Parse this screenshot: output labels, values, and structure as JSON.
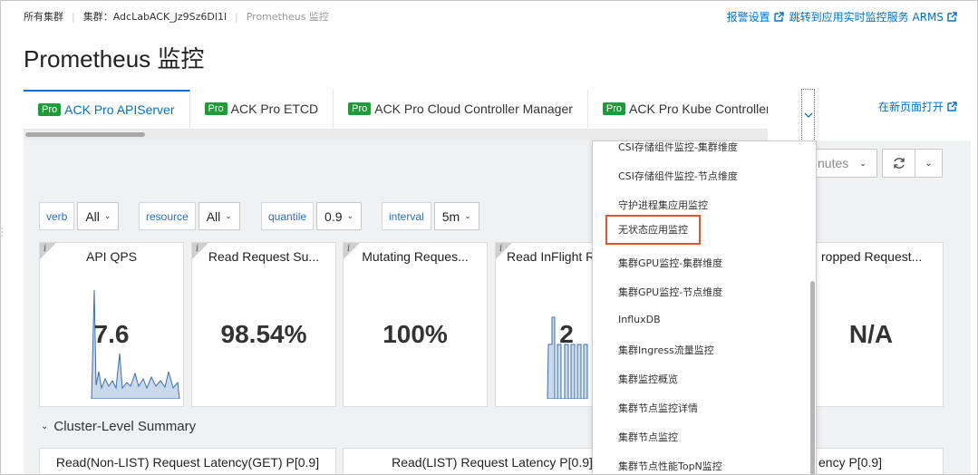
{
  "breadcrumb": {
    "items": [
      "所有集群",
      "集群：",
      "AdcLabACK_Jz9Sz6Dl1l",
      "Prometheus 监控"
    ]
  },
  "header_links": {
    "alarm": "报警设置",
    "arms": "跳转到应用实时监控服务 ARMS"
  },
  "page_title": "Prometheus 监控",
  "tabs": [
    {
      "badge": "Pro",
      "label": "ACK Pro APIServer"
    },
    {
      "badge": "Pro",
      "label": "ACK Pro ETCD"
    },
    {
      "badge": "Pro",
      "label": "ACK Pro Cloud Controller Manager"
    },
    {
      "badge": "Pro",
      "label": "ACK Pro Kube Controller Manager"
    }
  ],
  "open_new_page": "在新页面打开",
  "time_range": {
    "text": "nutes"
  },
  "filters": [
    {
      "label": "verb",
      "value": "All"
    },
    {
      "label": "resource",
      "value": "All"
    },
    {
      "label": "quantile",
      "value": "0.9"
    },
    {
      "label": "interval",
      "value": "5m"
    }
  ],
  "panels": [
    {
      "title": "API QPS",
      "value": "7.6"
    },
    {
      "title": "Read Request Su...",
      "value": "98.54%"
    },
    {
      "title": "Mutating Reques...",
      "value": "100%"
    },
    {
      "title": "Read InFlight R",
      "value": "2"
    },
    {
      "title": "ropped Request...",
      "value": "N/A"
    }
  ],
  "section_title": "Cluster-Level Summary",
  "bottom_panels": [
    {
      "title": "Read(Non-LIST) Request Latency(GET) P[0.9]"
    },
    {
      "title": "Read(LIST) Request Latency P[0.9]"
    },
    {
      "title": "ency P[0.9]"
    }
  ],
  "dropdown": {
    "items": [
      "CSI存储组件监控-集群维度",
      "CSI存储组件监控-节点维度",
      "守护进程集应用监控",
      "无状态应用监控",
      "集群GPU监控-集群维度",
      "集群GPU监控-节点维度",
      "InfluxDB",
      "集群Ingress流量监控",
      "集群监控概览",
      "集群节点监控详情",
      "集群节点监控",
      "集群节点性能TopN监控"
    ],
    "highlighted": "无状态应用监控"
  },
  "colors": {
    "link": "#0070cc",
    "pro_badge": "#1e9c3a",
    "highlight_border": "#e0542d",
    "chart_line": "#3a6fb0"
  }
}
